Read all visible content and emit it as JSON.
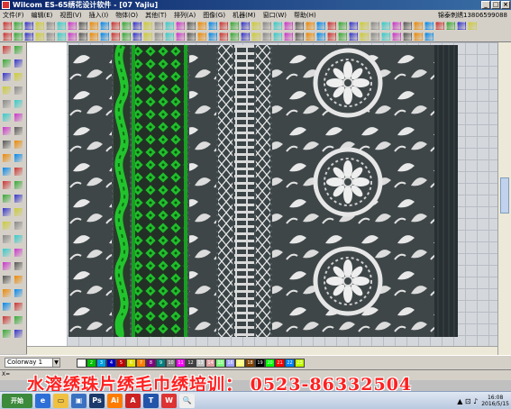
{
  "window": {
    "title": "Wilcom ES-65绣花设计软件 - [07    Yajiu]"
  },
  "menu": {
    "items": [
      "文件(F)",
      "编辑(E)",
      "视图(V)",
      "插入(I)",
      "物体(O)",
      "其他(T)",
      "排列(A)",
      "图像(G)",
      "机器(M)",
      "窗口(W)",
      "帮助(H)"
    ],
    "right_info": "锦泰刺绣13806599088"
  },
  "status": {
    "colorway": "Colorway 1",
    "coordinates": "X=   "
  },
  "palette": {
    "colors": [
      "#ffffff",
      "#00c000",
      "#00a0e0",
      "#0000c0",
      "#c00000",
      "#e0e000",
      "#ff8000",
      "#800080",
      "#008080",
      "#808080",
      "#ff00ff",
      "#404040",
      "#c0c0c0",
      "#e0a0a0",
      "#80ff80",
      "#a0a0ff",
      "#ffff80",
      "#804000",
      "#000000",
      "#00ff00",
      "#ff0000",
      "#0080ff",
      "#c0ff00"
    ],
    "labels": [
      "1",
      "2",
      "3",
      "4",
      "5",
      "6",
      "7",
      "8",
      "9",
      "10",
      "11",
      "12",
      "13",
      "14",
      "15",
      "16",
      "17",
      "18",
      "19",
      "20",
      "21",
      "22",
      "23"
    ]
  },
  "banner": {
    "text": "水溶绣珠片绣毛巾绣培训： 0523-86332504"
  },
  "taskbar": {
    "start_label": "开始",
    "clock_time": "16:08",
    "clock_date": "2016/5/15"
  }
}
